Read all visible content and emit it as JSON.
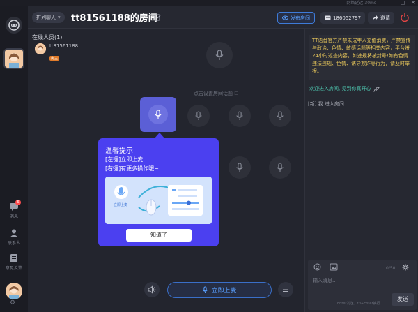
{
  "window": {
    "net_status": "网络延迟:30ms",
    "minimize": "—",
    "maximize": "□",
    "close": "✕"
  },
  "rail": {
    "messages_label": "消息",
    "messages_badge": "6",
    "contacts_label": "联系人",
    "feedback_label": "意见反馈"
  },
  "header": {
    "mode_label": "扩列聊天",
    "room_title": "tt81561188的房间",
    "publish_label": "发布房间",
    "phone_label": "186052797",
    "invite_label": "邀请"
  },
  "members": {
    "title": "在线人员(1)",
    "items": [
      {
        "name": "tt81561188",
        "tag": "房主"
      }
    ]
  },
  "stage": {
    "topic_placeholder": "点击设置房间话题"
  },
  "popup": {
    "title": "温馨提示",
    "line1": "[左键]立即上麦",
    "line2": "[右键]有更多操作哦~",
    "illus_label": "立即上麦",
    "ok_label": "知道了"
  },
  "controls": {
    "mic_up_label": "立即上麦"
  },
  "chat": {
    "notice": "TT语音官方严禁未成年人充值消费，严禁宣传与政治、色情、敏感话题等相关内容，平台将24小时巡查内容，如违规将被封号!如有色情违法违规、色情、诱导欺诈等行为，请及时举报。",
    "welcome": "欢迎进入房间, 见到你真开心",
    "system_message": "[新] 我 进入房间",
    "input_placeholder": "输入消息...",
    "char_count": "0/50",
    "hint": "Enter发送,Ctrl+Enter换行",
    "send_label": "发送"
  },
  "colors": {
    "accent_blue": "#3e7bd8",
    "popup_purple": "#4b40f0",
    "seat_active": "#5b5fd6",
    "notice_yellow": "#e6c55a",
    "welcome_teal": "#4ec7b0"
  }
}
